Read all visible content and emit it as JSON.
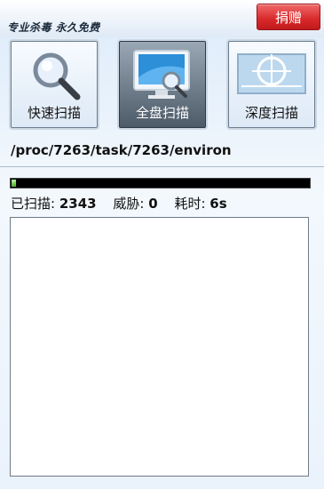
{
  "header": {
    "title": "专业杀毒 永久免费",
    "donate_label": "捐赠"
  },
  "tiles": [
    {
      "label": "快速扫描",
      "icon": "magnifier-icon",
      "selected": false
    },
    {
      "label": "全盘扫描",
      "icon": "monitor-magnifier-icon",
      "selected": true
    },
    {
      "label": "深度扫描",
      "icon": "target-crosshair-icon",
      "selected": false
    }
  ],
  "scan": {
    "current_path": "/proc/7263/task/7263/environ",
    "progress_fraction": 0.015,
    "scanned_label": "已扫描:",
    "scanned_value": "2343",
    "threats_label": "威胁:",
    "threats_value": "0",
    "elapsed_label": "耗时:",
    "elapsed_value": "6s"
  },
  "colors": {
    "donate": "#d8282a",
    "progress_fill": "#4ea92b",
    "background": "#dcebfa"
  }
}
